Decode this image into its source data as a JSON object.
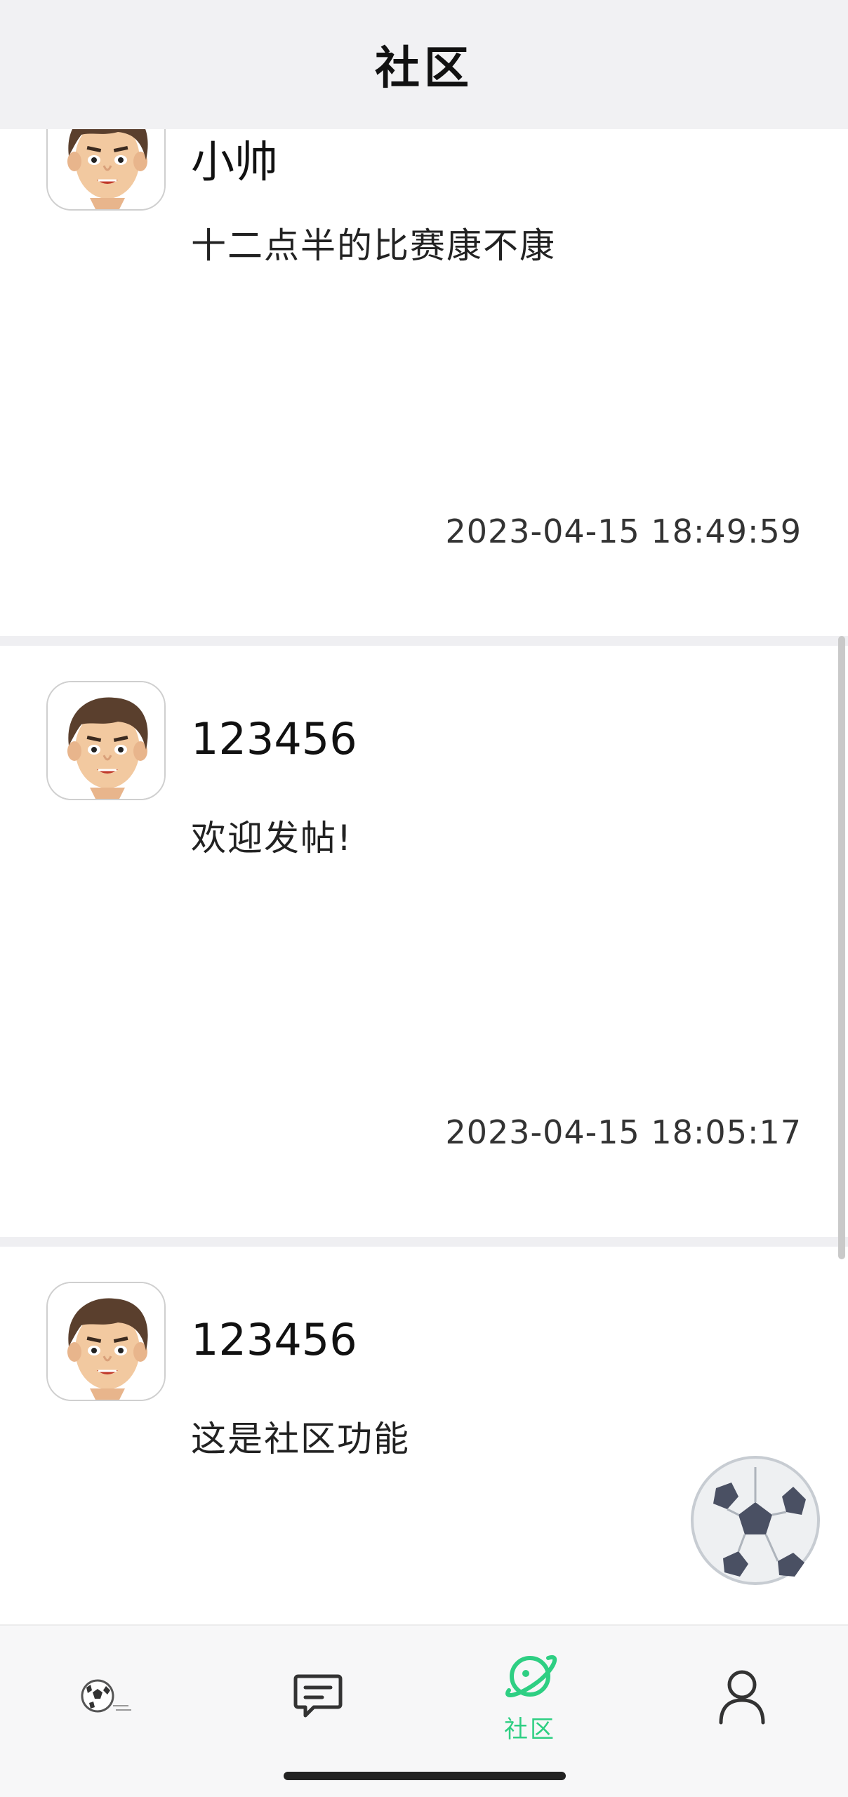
{
  "header": {
    "title": "社区"
  },
  "posts": [
    {
      "author": "小帅",
      "content": "十二点半的比赛康不康",
      "time": "2023-04-15 18:49:59"
    },
    {
      "author": "123456",
      "content": "欢迎发帖!",
      "time": "2023-04-15 18:05:17"
    },
    {
      "author": "123456",
      "content": "这是社区功能",
      "time": ""
    }
  ],
  "tabs": [
    {
      "icon": "soccer-ball-icon",
      "label": "",
      "active": false
    },
    {
      "icon": "message-icon",
      "label": "",
      "active": false
    },
    {
      "icon": "planet-icon",
      "label": "社区",
      "active": true
    },
    {
      "icon": "person-icon",
      "label": "",
      "active": false
    }
  ],
  "colors": {
    "accent": "#2ecf83",
    "header_bg": "#f1f1f3",
    "divider": "#efeff2"
  },
  "floating_button": {
    "icon": "soccer-ball-icon"
  }
}
